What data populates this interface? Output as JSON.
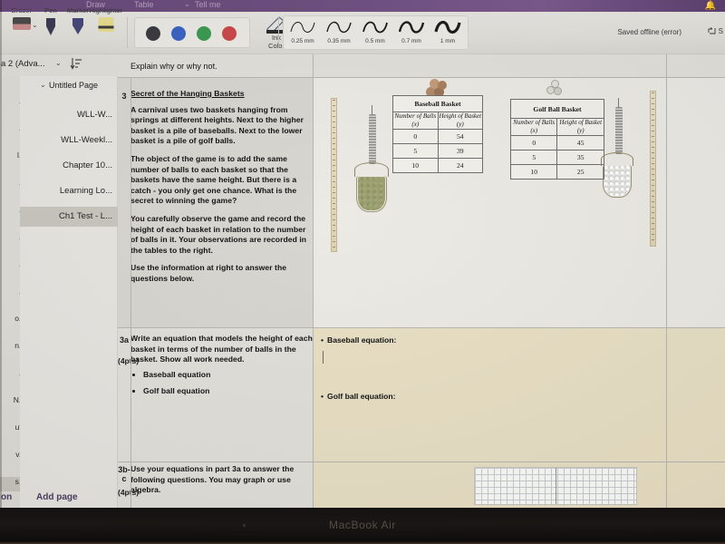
{
  "app": {
    "title_strip_menus": [
      "Draw",
      "Table",
      "Tell me"
    ],
    "notification_icon": "bell-icon",
    "save_status": "Saved offline (error)",
    "share_label": "S",
    "share_icon": "share-icon"
  },
  "toolbar": {
    "pens": [
      {
        "label": "Eraser",
        "icon": "eraser-icon"
      },
      {
        "label": "Pen",
        "icon": "pen-icon"
      },
      {
        "label": "Marker",
        "icon": "marker-icon"
      },
      {
        "label": "Highlighter",
        "icon": "highlighter-icon"
      }
    ],
    "colors": [
      {
        "name": "black",
        "hex": "#3b3b42"
      },
      {
        "name": "blue",
        "hex": "#3a63c4"
      },
      {
        "name": "green",
        "hex": "#3c9a52"
      },
      {
        "name": "red",
        "hex": "#cc4949"
      }
    ],
    "ink_color": {
      "line1": "Ink",
      "line2": "Color",
      "icon": "pen-nib-icon",
      "caret": "chevron-down-icon"
    },
    "thickness": [
      {
        "label": "0.25 mm",
        "stroke": 1.0
      },
      {
        "label": "0.35 mm",
        "stroke": 1.4
      },
      {
        "label": "0.5 mm",
        "stroke": 1.8
      },
      {
        "label": "0.7 mm",
        "stroke": 2.4
      },
      {
        "label": "1 mm",
        "stroke": 3.2
      }
    ]
  },
  "section_header": {
    "notebook_name": "a 2 (Adva...",
    "caret_icon": "chevron-down-icon",
    "sort_icon": "sort-icon"
  },
  "rail": {
    "items": [
      "...",
      "...",
      "l...",
      "...",
      "...",
      "...",
      "...",
      "...",
      "o...",
      "n...",
      "...",
      "N...",
      "uts",
      "v...",
      "s..."
    ],
    "selected_index": 14,
    "footer_label": "on"
  },
  "pages": {
    "group_label": "Untitled Page",
    "group_caret": "chevron-down-icon",
    "items": [
      {
        "label": "WLL-W..."
      },
      {
        "label": "WLL-Weekl..."
      },
      {
        "label": "Chapter 10..."
      },
      {
        "label": "Learning Lo..."
      },
      {
        "label": "Ch1 Test - L..."
      }
    ],
    "selected_index": 4,
    "add_page_label": "Add page"
  },
  "document": {
    "row_top_partial": {
      "text": "Explain why or why not."
    },
    "rows": [
      {
        "number": "3",
        "points": "",
        "title": "Secret of the Hanging Baskets",
        "paragraphs": [
          "A carnival uses two baskets hanging from springs at different heights. Next to the higher basket is a pile of baseballs. Next to the lower basket is a pile of golf balls.",
          "The object of the game is to add the same number of balls to each basket so that the baskets have the same height. But there is a catch - you only get one chance.  What is the secret to winning the game?",
          "You carefully observe the game and record the height of each basket in relation to the number of balls in it. Your observations are recorded in the tables to the right.",
          "Use the information at right to answer the questions below."
        ],
        "bullets": []
      },
      {
        "number": "3a",
        "points": "(4pts)",
        "title": "",
        "paragraphs": [
          "Write an equation that models the height of each basket in terms of the number of balls in the basket.  Show all work needed."
        ],
        "bullets": [
          "Baseball equation",
          "Golf ball equation"
        ],
        "answer_bullets": [
          "Baseball equation:",
          "Golf ball equation:"
        ]
      },
      {
        "number": "3b-c",
        "points": "(4pts)",
        "title": "",
        "paragraphs": [
          "Use your equations in part 3a to answer the following questions. You may graph or use algebra."
        ],
        "bullets": []
      }
    ],
    "figure": {
      "left_ruler_icon": "ruler-icon",
      "right_ruler_icon": "ruler-icon",
      "baseball_basket_icon": "hanging-basket-baseballs-icon",
      "golfball_basket_icon": "hanging-basket-golfballs-icon",
      "baseball_pile_icon": "baseball-pile-icon",
      "golfball_pile_icon": "golfball-pile-icon"
    }
  },
  "chart_data": [
    {
      "type": "table",
      "title": "Baseball Basket",
      "columns": [
        "Number of Balls (x)",
        "Height of Basket (y)"
      ],
      "x": [
        0,
        5,
        10
      ],
      "values": [
        54,
        39,
        24
      ],
      "rows": [
        [
          "0",
          "54"
        ],
        [
          "5",
          "39"
        ],
        [
          "10",
          "24"
        ]
      ],
      "xlabel": "Number of Balls (x)",
      "ylabel": "Height of Basket (y)"
    },
    {
      "type": "table",
      "title": "Golf Ball Basket",
      "columns": [
        "Number of Balls (x)",
        "Height of Basket (y)"
      ],
      "x": [
        0,
        5,
        10
      ],
      "values": [
        45,
        35,
        25
      ],
      "rows": [
        [
          "0",
          "45"
        ],
        [
          "5",
          "35"
        ],
        [
          "10",
          "25"
        ]
      ],
      "xlabel": "Number of Balls (x)",
      "ylabel": "Height of Basket (y)"
    }
  ],
  "bezel": {
    "brand": "MacBook Air"
  }
}
